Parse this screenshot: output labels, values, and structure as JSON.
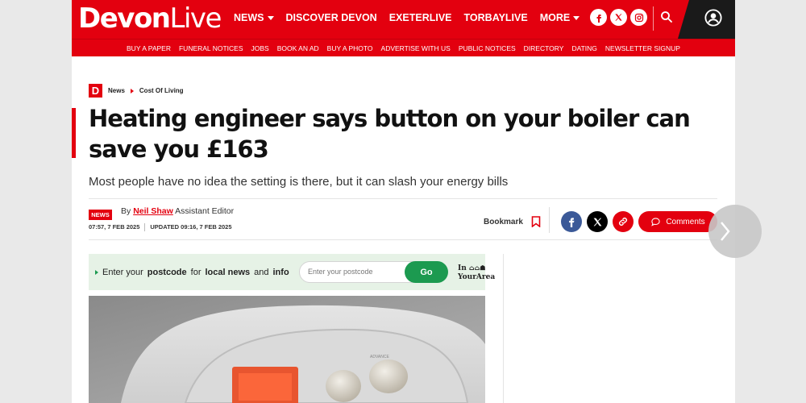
{
  "brand": {
    "logo_bold": "Devon",
    "logo_light": "Live"
  },
  "nav": {
    "main": [
      {
        "label": "NEWS",
        "dropdown": true
      },
      {
        "label": "DISCOVER DEVON",
        "dropdown": false
      },
      {
        "label": "EXETERLIVE",
        "dropdown": false
      },
      {
        "label": "TORBAYLIVE",
        "dropdown": false
      },
      {
        "label": "MORE",
        "dropdown": true
      }
    ],
    "social_icons": [
      "facebook-icon",
      "x-icon",
      "instagram-icon"
    ],
    "sub": [
      "BUY A PAPER",
      "FUNERAL NOTICES",
      "JOBS",
      "BOOK AN AD",
      "BUY A PHOTO",
      "ADVERTISE WITH US",
      "PUBLIC NOTICES",
      "DIRECTORY",
      "DATING",
      "NEWSLETTER SIGNUP"
    ]
  },
  "breadcrumb": {
    "logo": "D",
    "items": [
      "News",
      "Cost Of Living"
    ]
  },
  "article": {
    "headline": "Heating engineer says button on your boiler can save you £163",
    "standfirst": "Most people have no idea the setting is there, but it can slash your energy bills",
    "badge": "NEWS",
    "by": "By",
    "author": "Neil Shaw",
    "role": "Assistant Editor",
    "published": "07:57, 7 FEB 2025",
    "updated": "UPDATED 09:16, 7 FEB 2025",
    "bookmark_label": "Bookmark",
    "comments_label": "Comments"
  },
  "postcode": {
    "prefix": "Enter your",
    "bold1": "postcode",
    "mid": "for",
    "bold2": "local news",
    "and": "and",
    "bold3": "info",
    "placeholder": "Enter your postcode",
    "go_label": "Go",
    "brand_line1": "In",
    "brand_line2": "YourArea"
  },
  "colors": {
    "brand_red": "#e3000f",
    "go_green": "#1c9a50",
    "facebook_blue": "#3b5998"
  }
}
